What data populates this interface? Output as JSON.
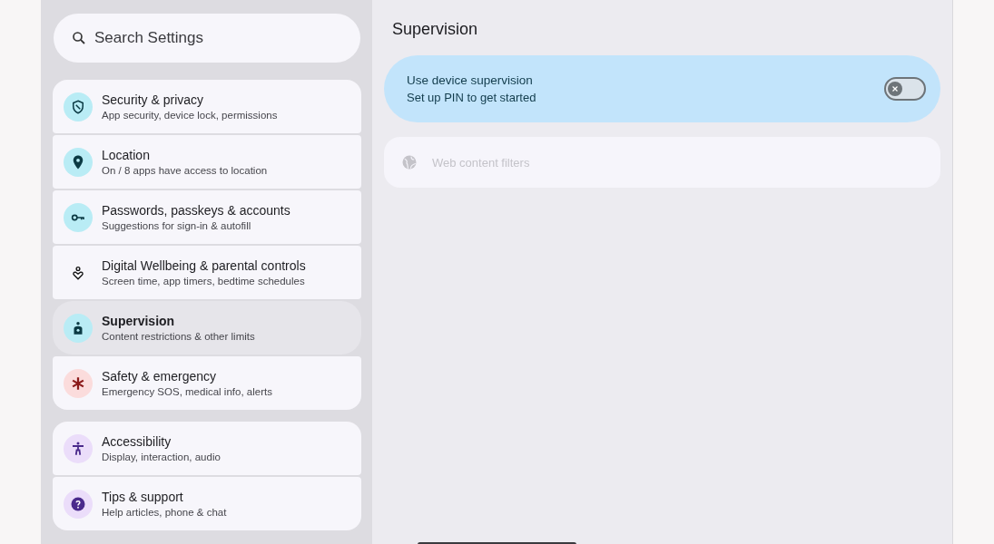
{
  "search": {
    "placeholder": "Search Settings"
  },
  "groups": [
    {
      "items": [
        {
          "title": "Security & privacy",
          "subtitle": "App security, device lock, permissions",
          "kind": "shield",
          "selected": false
        },
        {
          "title": "Location",
          "subtitle": "On / 8 apps have access to location",
          "kind": "pin",
          "selected": false
        },
        {
          "title": "Passwords, passkeys & accounts",
          "subtitle": "Suggestions for sign-in & autofill",
          "kind": "key",
          "selected": false
        },
        {
          "title": "Digital Wellbeing & parental controls",
          "subtitle": "Screen time, app timers, bedtime schedules",
          "kind": "wellbeing",
          "selected": false
        },
        {
          "title": "Supervision",
          "subtitle": "Content restrictions & other limits",
          "kind": "supervision",
          "selected": true
        },
        {
          "title": "Safety & emergency",
          "subtitle": "Emergency SOS, medical info, alerts",
          "kind": "asterisk",
          "selected": false
        }
      ]
    },
    {
      "items": [
        {
          "title": "Accessibility",
          "subtitle": "Display, interaction, audio",
          "kind": "accessibility",
          "selected": false
        },
        {
          "title": "Tips & support",
          "subtitle": "Help articles, phone & chat",
          "kind": "help",
          "selected": false
        }
      ]
    }
  ],
  "detail": {
    "title": "Supervision",
    "main_switch": {
      "title": "Use device supervision",
      "subtitle": "Set up PIN to get started",
      "on": false
    },
    "options": [
      {
        "label": "Web content filters",
        "kind": "globe",
        "disabled": true
      }
    ]
  }
}
